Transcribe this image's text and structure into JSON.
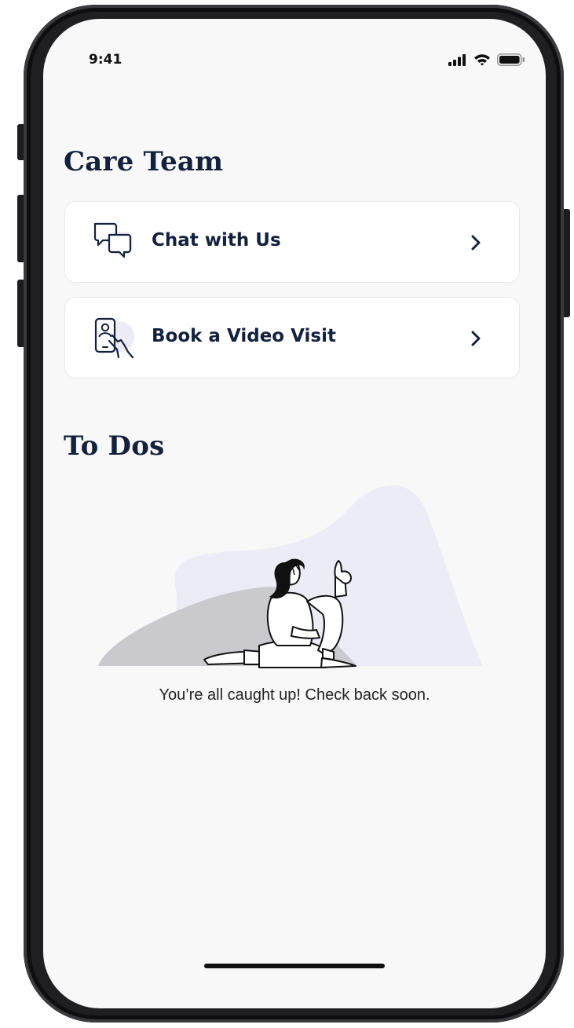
{
  "status_bar": {
    "time": "9:41",
    "icons": [
      "cellular-signal-icon",
      "wifi-icon",
      "battery-icon"
    ]
  },
  "care_team": {
    "title": "Care Team",
    "items": [
      {
        "label": "Chat with Us",
        "icon": "chat-bubbles-icon"
      },
      {
        "label": "Book a Video Visit",
        "icon": "phone-video-icon"
      }
    ]
  },
  "todos": {
    "title": "To Dos",
    "empty_illustration": "woman-thumbs-up-illustration",
    "empty_message": "You’re all caught up! Check back soon."
  },
  "colors": {
    "heading": "#14213d",
    "screen_bg": "#f8f8f8",
    "illustration_lavender": "#ececf6",
    "illustration_grey": "#c9c9ce"
  }
}
